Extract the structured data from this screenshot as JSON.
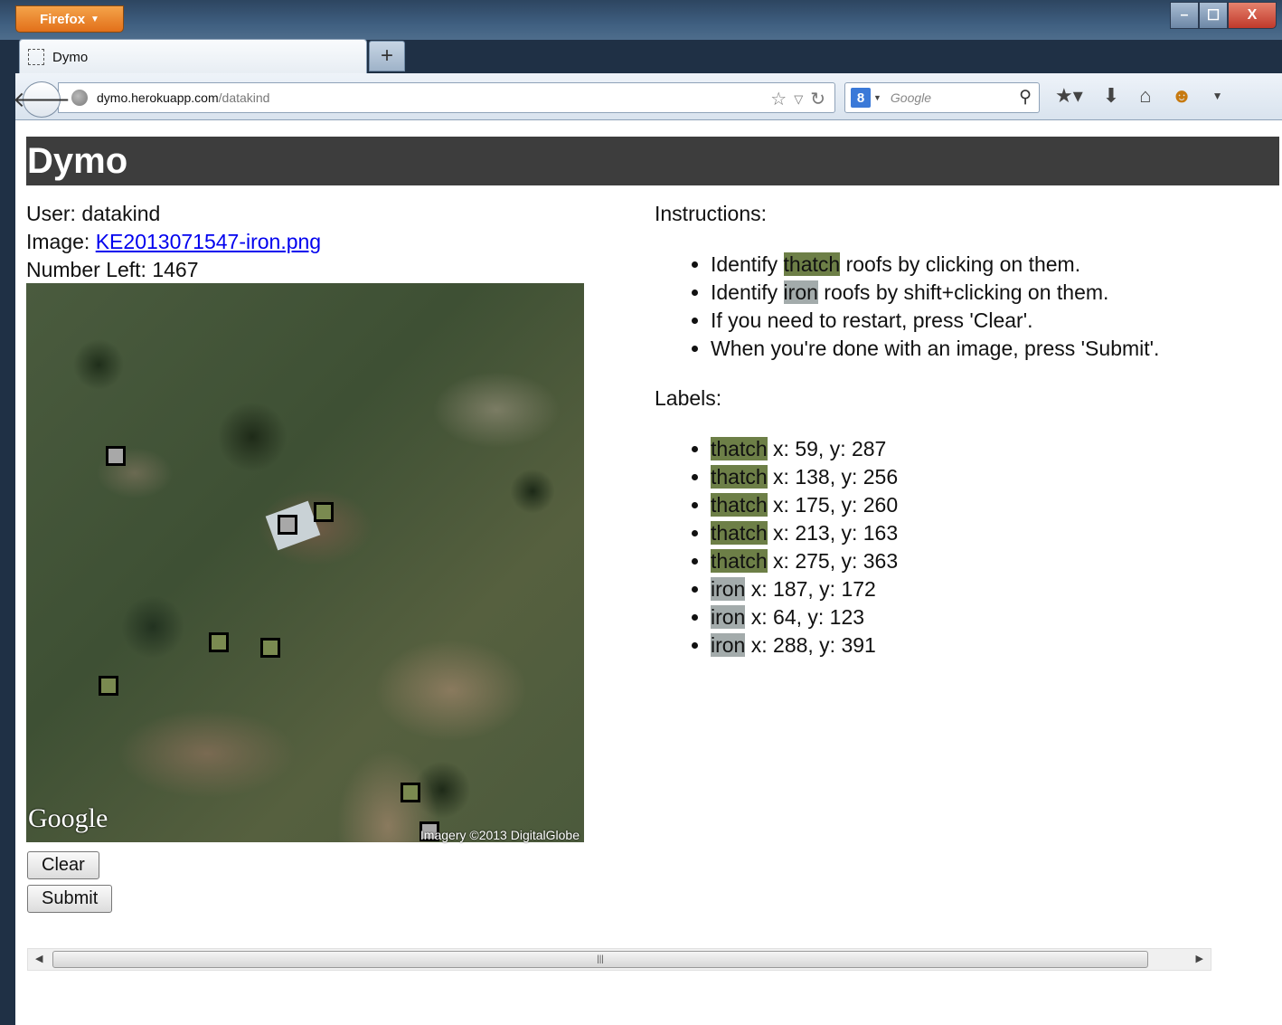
{
  "browser": {
    "menu_button": "Firefox",
    "tab_title": "Dymo",
    "new_tab": "+",
    "url_host": "dymo.herokuapp.com",
    "url_path": "/datakind",
    "search_placeholder": "Google",
    "search_engine_icon": "8"
  },
  "page": {
    "title": "Dymo",
    "user_label": "User:",
    "user_value": "datakind",
    "image_label": "Image:",
    "image_link": "KE2013071547-iron.png",
    "number_left_label": "Number Left:",
    "number_left_value": "1467",
    "map_logo": "Google",
    "map_copyright": "Imagery ©2013 DigitalGlobe",
    "clear_button": "Clear",
    "submit_button": "Submit"
  },
  "instructions": {
    "heading": "Instructions:",
    "items": [
      {
        "pre": "Identify ",
        "tag": "thatch",
        "post": " roofs by clicking on them."
      },
      {
        "pre": "Identify ",
        "tag": "iron",
        "post": " roofs by shift+clicking on them."
      },
      {
        "text": "If you need to restart, press 'Clear'."
      },
      {
        "text": "When you're done with an image, press 'Submit'."
      }
    ]
  },
  "labels": {
    "heading": "Labels:",
    "items": [
      {
        "tag": "thatch",
        "coords": " x: 59, y: 287"
      },
      {
        "tag": "thatch",
        "coords": " x: 138, y: 256"
      },
      {
        "tag": "thatch",
        "coords": " x: 175, y: 260"
      },
      {
        "tag": "thatch",
        "coords": " x: 213, y: 163"
      },
      {
        "tag": "thatch",
        "coords": " x: 275, y: 363"
      },
      {
        "tag": "iron",
        "coords": " x: 187, y: 172"
      },
      {
        "tag": "iron",
        "coords": " x: 64, y: 123"
      },
      {
        "tag": "iron",
        "coords": " x: 288, y: 391"
      }
    ]
  },
  "colors": {
    "thatch": "#6d7f47",
    "iron": "#a3abab",
    "header_bg": "#3d3d3d"
  }
}
